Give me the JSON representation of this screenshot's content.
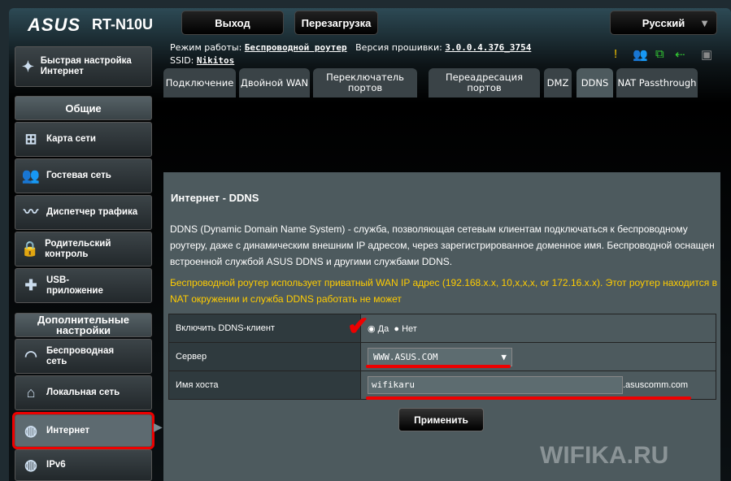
{
  "header": {
    "brand": "ASUS",
    "model": "RT-N10U",
    "logout": "Выход",
    "reboot": "Перезагрузка",
    "language": "Русский"
  },
  "info": {
    "mode_label": "Режим работы:",
    "mode_value": "Беспроводной роутер",
    "fw_label": "Версия прошивки:",
    "fw_value": "3.0.0.4.376_3754",
    "ssid_label": "SSID:",
    "ssid_value": "Nikitos"
  },
  "tabs": [
    "Подключение",
    "Двойной WAN",
    "Переключатель портов",
    "Переадресация портов",
    "DMZ",
    "DDNS",
    "NAT Passthrough"
  ],
  "sidebar": {
    "quick": "Быстрая настройка Интернет",
    "general": "Общие",
    "items": [
      "Карта сети",
      "Гостевая сеть",
      "Диспетчер трафика",
      "Родительский контроль",
      "USB-приложение"
    ],
    "advanced": "Дополнительные настройки",
    "adv_items": [
      "Беспроводная сеть",
      "Локальная сеть",
      "Интернет",
      "IPv6"
    ]
  },
  "main": {
    "title": "Интернет - DDNS",
    "desc": "DDNS (Dynamic Domain Name System) - служба, позволяющая сетевым клиентам подключаться к беспроводному роутеру, даже с динамическим внешним IP адресом, через зарегистрированное доменное имя. Беспроводной оснащен встроенной службой ASUS DDNS и другими службами DDNS.",
    "warning": "Беспроводной роутер использует приватный WAN IP адрес (192.168.x.x, 10,x,x,x, or 172.16.x.x). Этот роутер находится в NAT окружении и служба DDNS работать не может",
    "enable_label": "Включить DDNS-клиент",
    "yes": "Да",
    "no": "Нет",
    "server_label": "Сервер",
    "server_value": "WWW.ASUS.COM",
    "host_label": "Имя хоста",
    "host_value": "wifikaru",
    "host_suffix": ".asuscomm.com",
    "apply": "Применить"
  },
  "watermark": "WIFIKA.RU"
}
